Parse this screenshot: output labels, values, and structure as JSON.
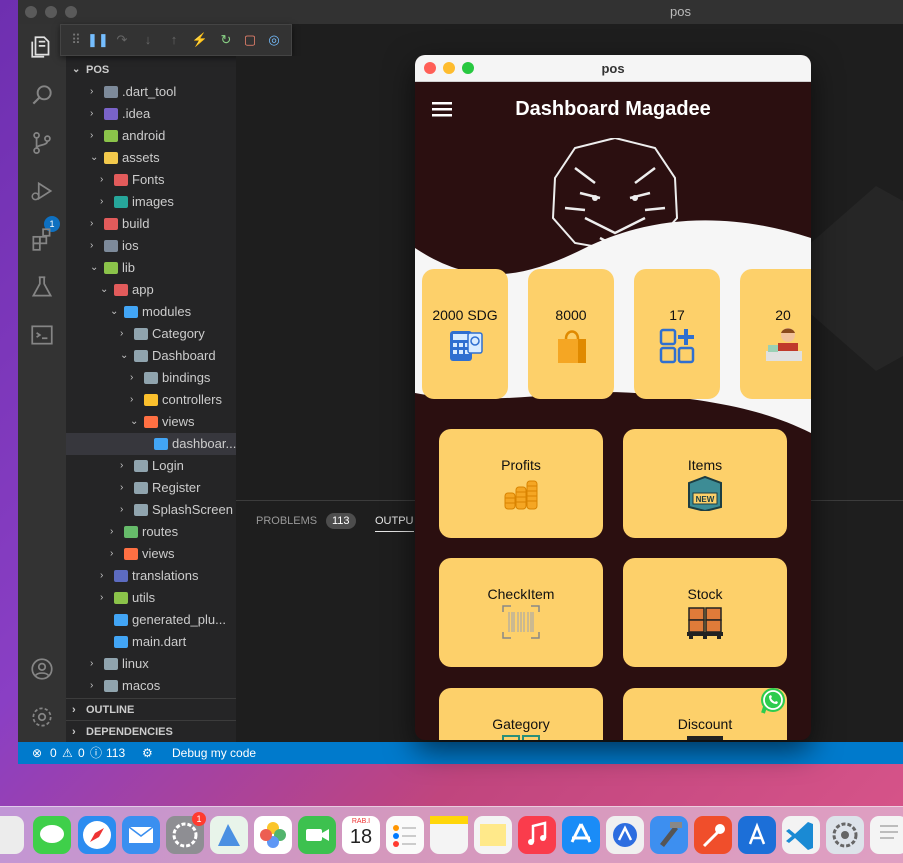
{
  "vscode": {
    "window_title": "pos",
    "explorer_root": "POS",
    "tree": [
      {
        "label": ".dart_tool",
        "depth": 1,
        "open": false,
        "color": "#7d8a9a"
      },
      {
        "label": ".idea",
        "depth": 1,
        "open": false,
        "color": "#7a63c9"
      },
      {
        "label": "android",
        "depth": 1,
        "open": false,
        "color": "#8bc34a"
      },
      {
        "label": "assets",
        "depth": 1,
        "open": true,
        "color": "#f2c94c"
      },
      {
        "label": "Fonts",
        "depth": 2,
        "open": false,
        "color": "#e25b5b"
      },
      {
        "label": "images",
        "depth": 2,
        "open": false,
        "color": "#26a69a"
      },
      {
        "label": "build",
        "depth": 1,
        "open": false,
        "color": "#e25b5b"
      },
      {
        "label": "ios",
        "depth": 1,
        "open": false,
        "color": "#7d8a9a"
      },
      {
        "label": "lib",
        "depth": 1,
        "open": true,
        "color": "#8bc34a"
      },
      {
        "label": "app",
        "depth": 2,
        "open": true,
        "color": "#e25b5b"
      },
      {
        "label": "modules",
        "depth": 3,
        "open": true,
        "color": "#42a5f5"
      },
      {
        "label": "Category",
        "depth": 4,
        "open": false,
        "color": "#90a4ae"
      },
      {
        "label": "Dashboard",
        "depth": 4,
        "open": true,
        "color": "#90a4ae"
      },
      {
        "label": "bindings",
        "depth": 5,
        "open": false,
        "color": "#90a4ae"
      },
      {
        "label": "controllers",
        "depth": 5,
        "open": false,
        "color": "#fbc02d"
      },
      {
        "label": "views",
        "depth": 5,
        "open": true,
        "color": "#ff7043"
      },
      {
        "label": "dashboar...",
        "depth": 6,
        "file": true,
        "color": "#42a5f5"
      },
      {
        "label": "Login",
        "depth": 4,
        "open": false,
        "color": "#90a4ae"
      },
      {
        "label": "Register",
        "depth": 4,
        "open": false,
        "color": "#90a4ae"
      },
      {
        "label": "SplashScreen",
        "depth": 4,
        "open": false,
        "color": "#90a4ae"
      },
      {
        "label": "routes",
        "depth": 3,
        "open": false,
        "color": "#66bb6a"
      },
      {
        "label": "views",
        "depth": 3,
        "open": false,
        "color": "#ff7043"
      },
      {
        "label": "translations",
        "depth": 2,
        "open": false,
        "color": "#5c6bc0"
      },
      {
        "label": "utils",
        "depth": 2,
        "open": false,
        "color": "#8bc34a"
      },
      {
        "label": "generated_plu...",
        "depth": 2,
        "file": true,
        "color": "#42a5f5"
      },
      {
        "label": "main.dart",
        "depth": 2,
        "file": true,
        "color": "#42a5f5"
      },
      {
        "label": "linux",
        "depth": 1,
        "open": false,
        "color": "#90a4ae"
      },
      {
        "label": "macos",
        "depth": 1,
        "open": false,
        "color": "#90a4ae"
      }
    ],
    "sections": {
      "outline": "OUTLINE",
      "dependencies": "DEPENDENCIES"
    },
    "run_debug_badge": "1",
    "panel": {
      "problems_label": "PROBLEMS",
      "problems_count": "113",
      "output_label": "OUTPU"
    },
    "status": {
      "errors": "0",
      "warnings": "0",
      "info": "113",
      "debug_label": "Debug my code"
    }
  },
  "pos_app": {
    "window_title": "pos",
    "app_title": "Dashboard  Magadee",
    "stats": [
      {
        "value": "2000 SDG",
        "icon": "calculator-icon"
      },
      {
        "value": "8000",
        "icon": "shopping-bag-icon"
      },
      {
        "value": "17",
        "icon": "category-grid-icon"
      },
      {
        "value": "20",
        "icon": "cashier-icon"
      }
    ],
    "menu": [
      {
        "label": "Profits",
        "icon": "coins-icon"
      },
      {
        "label": "Items",
        "icon": "new-box-icon"
      },
      {
        "label": "CheckItem",
        "icon": "barcode-icon"
      },
      {
        "label": "Stock",
        "icon": "pallet-icon"
      },
      {
        "label": "Gategory",
        "icon": "grid-icon"
      },
      {
        "label": "Discount",
        "icon": "discount-icon"
      }
    ],
    "colors": {
      "background": "#2b0f10",
      "card": "#fdd06a",
      "wave": "#f6f6f6"
    }
  },
  "dock": {
    "calendar_month": "RAB.I",
    "calendar_day": "18",
    "settings_badge": "1"
  }
}
